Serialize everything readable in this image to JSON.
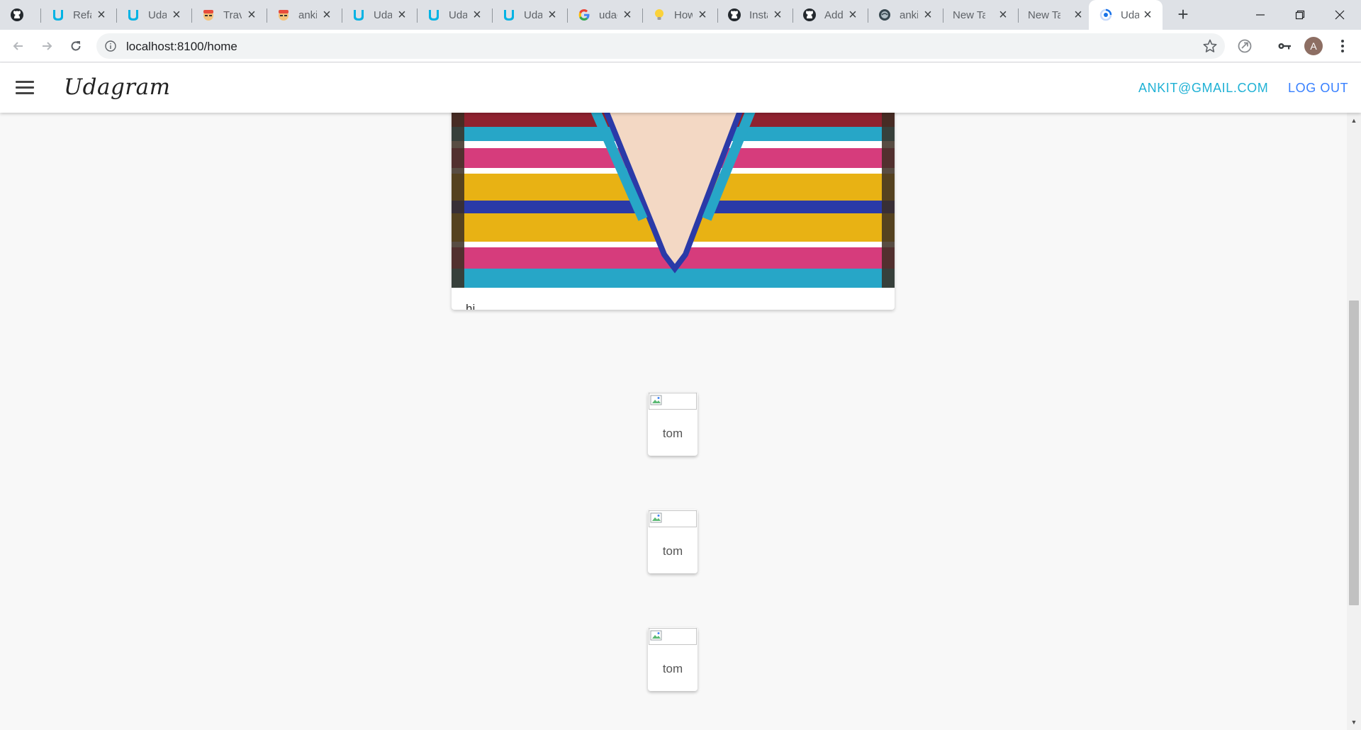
{
  "browser": {
    "tabs": [
      {
        "title": "",
        "icon": "github-icon"
      },
      {
        "title": "Refactor",
        "icon": "udacity-icon"
      },
      {
        "title": "Udacity",
        "icon": "udacity-icon"
      },
      {
        "title": "Travel",
        "icon": "avatar-emoji-icon"
      },
      {
        "title": "ankit",
        "icon": "avatar-emoji-icon"
      },
      {
        "title": "Udacity",
        "icon": "udacity-icon"
      },
      {
        "title": "Udacity",
        "icon": "udacity-icon"
      },
      {
        "title": "Udacity",
        "icon": "udacity-icon"
      },
      {
        "title": "udacity",
        "icon": "google-icon"
      },
      {
        "title": "How",
        "icon": "lightbulb-icon"
      },
      {
        "title": "Instagram",
        "icon": "github-icon"
      },
      {
        "title": "Add",
        "icon": "github-icon"
      },
      {
        "title": "ankit",
        "icon": "globe-icon"
      },
      {
        "title": "New Tab",
        "icon": ""
      },
      {
        "title": "New Tab",
        "icon": ""
      },
      {
        "title": "Udagram",
        "icon": "loading-icon"
      }
    ],
    "url": "localhost:8100/home",
    "profile_initial": "A"
  },
  "header": {
    "title": "Udagram",
    "user_email": "ANKIT@GMAIL.COM",
    "logout_label": "LOG OUT",
    "link_color": "#1fb1d5",
    "logout_color": "#3880ff"
  },
  "feed": {
    "caption": "hi"
  },
  "users": [
    {
      "name": "tom"
    },
    {
      "name": "tom"
    },
    {
      "name": "tom"
    }
  ]
}
